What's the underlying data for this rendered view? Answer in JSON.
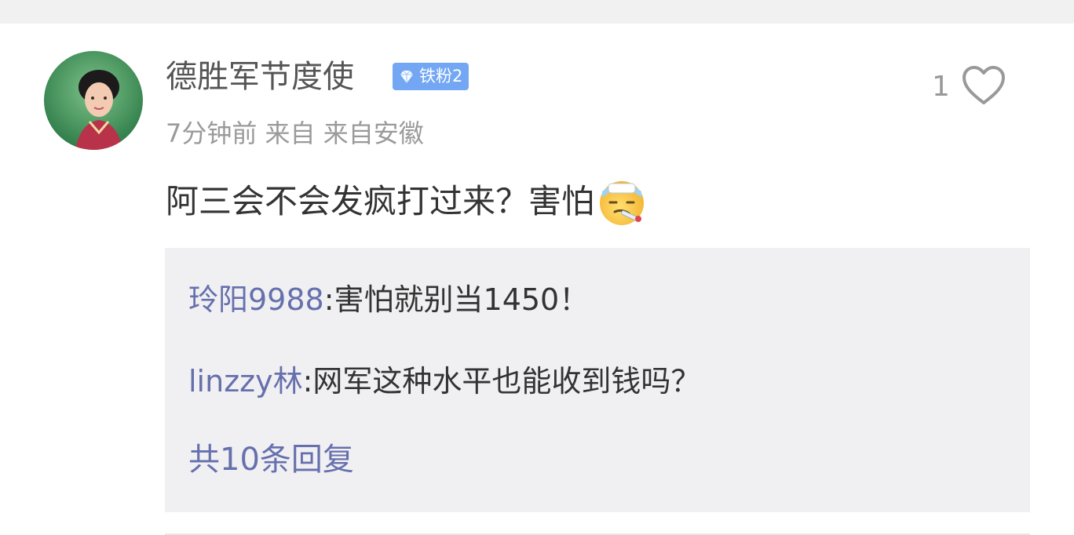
{
  "comment": {
    "username": "德胜军节度使",
    "badge": {
      "label": "铁粉2",
      "icon": "diamond-icon",
      "color": "#73a7f4"
    },
    "meta": "7分钟前 来自 来自安徽",
    "like_count": "1",
    "text": "阿三会不会发疯打过来？害怕",
    "emoji": "sick-thermometer-emoji"
  },
  "replies": [
    {
      "author": "玲阳9988",
      "text": ":害怕就别当1450！"
    },
    {
      "author": "linzzy林",
      "text": ":网军这种水平也能收到钱吗？"
    }
  ],
  "more_replies": "共10条回复",
  "colors": {
    "link": "#6670ad",
    "reply_bg": "#f0f0f2"
  }
}
